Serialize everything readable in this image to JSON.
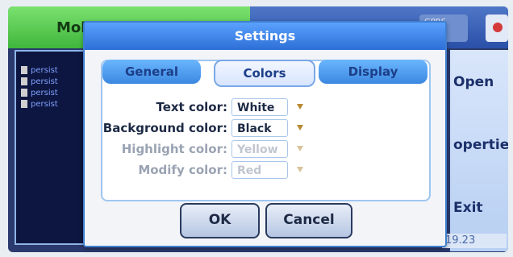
{
  "app": {
    "title": "Mobi"
  },
  "status": {
    "indicator": "GPRS"
  },
  "left_list": {
    "items": [
      "persist",
      "persist",
      "persist",
      "persist"
    ]
  },
  "softkeys": {
    "open": "Open",
    "properties": "operties",
    "exit": "Exit"
  },
  "clock": "19.23",
  "dialog": {
    "title": "Settings",
    "tabs": [
      {
        "label": "General",
        "active": false
      },
      {
        "label": "Colors",
        "active": true
      },
      {
        "label": "Display",
        "active": false
      }
    ],
    "fields": [
      {
        "label": "Text color:",
        "value": "White",
        "enabled": true
      },
      {
        "label": "Background color:",
        "value": "Black",
        "enabled": true
      },
      {
        "label": "Highlight color:",
        "value": "Yellow",
        "enabled": false
      },
      {
        "label": "Modify color:",
        "value": "Red",
        "enabled": false
      }
    ],
    "ok": "OK",
    "cancel": "Cancel"
  },
  "colors": {
    "accent": "#3b88e0",
    "title_green": "#3fb63c",
    "dialog_bg": "#f2f4f8"
  }
}
